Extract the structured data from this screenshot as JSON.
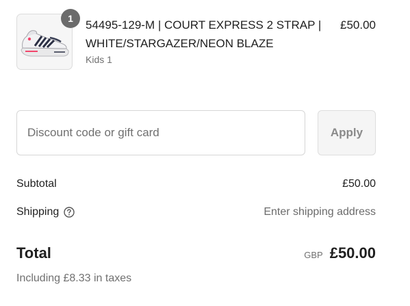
{
  "product": {
    "quantity": "1",
    "title": "54495-129-M | COURT EXPRESS 2 STRAP | WHITE/STARGAZER/NEON BLAZE",
    "variant": "Kids 1",
    "price": "£50.00",
    "image_icon": "shoe-image"
  },
  "discount": {
    "placeholder": "Discount code or gift card",
    "value": "",
    "apply_label": "Apply"
  },
  "summary": {
    "subtotal_label": "Subtotal",
    "subtotal_value": "£50.00",
    "shipping_label": "Shipping",
    "shipping_help_icon": "question-circle-icon",
    "shipping_value": "Enter shipping address",
    "total_label": "Total",
    "currency": "GBP",
    "total_value": "£50.00",
    "taxes_note": "Including £8.33 in taxes"
  }
}
